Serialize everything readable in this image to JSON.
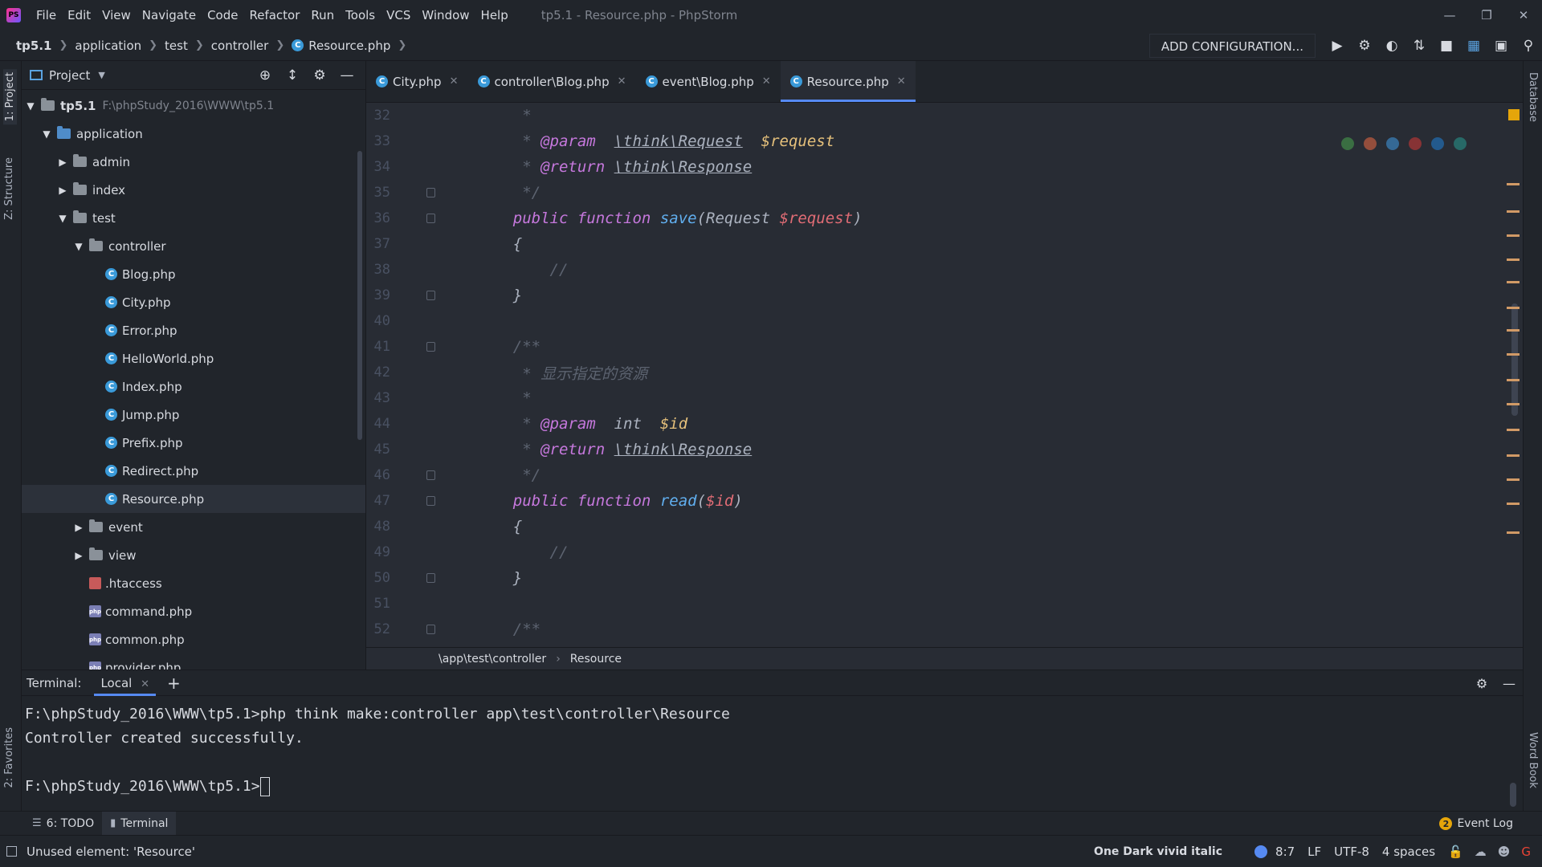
{
  "menu": [
    "File",
    "Edit",
    "View",
    "Navigate",
    "Code",
    "Refactor",
    "Run",
    "Tools",
    "VCS",
    "Window",
    "Help"
  ],
  "window_title": "tp5.1 - Resource.php - PhpStorm",
  "breadcrumbs": [
    "tp5.1",
    "application",
    "test",
    "controller",
    "Resource.php"
  ],
  "run_config": "ADD CONFIGURATION...",
  "left_tabs": {
    "project": "1: Project",
    "structure": "Z: Structure",
    "favorites": "2: Favorites"
  },
  "right_tabs": {
    "database": "Database",
    "wordbook": "Word Book"
  },
  "project_panel": {
    "title": "Project",
    "root": {
      "name": "tp5.1",
      "path": "F:\\phpStudy_2016\\WWW\\tp5.1"
    },
    "tree": [
      {
        "label": "application",
        "depth": 1,
        "kind": "folder-blue",
        "expanded": true
      },
      {
        "label": "admin",
        "depth": 2,
        "kind": "folder",
        "expanded": false
      },
      {
        "label": "index",
        "depth": 2,
        "kind": "folder",
        "expanded": false
      },
      {
        "label": "test",
        "depth": 2,
        "kind": "folder",
        "expanded": true
      },
      {
        "label": "controller",
        "depth": 3,
        "kind": "folder",
        "expanded": true
      },
      {
        "label": "Blog.php",
        "depth": 4,
        "kind": "php-class"
      },
      {
        "label": "City.php",
        "depth": 4,
        "kind": "php-class"
      },
      {
        "label": "Error.php",
        "depth": 4,
        "kind": "php-class"
      },
      {
        "label": "HelloWorld.php",
        "depth": 4,
        "kind": "php-class"
      },
      {
        "label": "Index.php",
        "depth": 4,
        "kind": "php-class"
      },
      {
        "label": "Jump.php",
        "depth": 4,
        "kind": "php-class"
      },
      {
        "label": "Prefix.php",
        "depth": 4,
        "kind": "php-class"
      },
      {
        "label": "Redirect.php",
        "depth": 4,
        "kind": "php-class"
      },
      {
        "label": "Resource.php",
        "depth": 4,
        "kind": "php-class",
        "selected": true
      },
      {
        "label": "event",
        "depth": 3,
        "kind": "folder",
        "expanded": false
      },
      {
        "label": "view",
        "depth": 3,
        "kind": "folder",
        "expanded": false
      },
      {
        "label": ".htaccess",
        "depth": 3,
        "kind": "htaccess"
      },
      {
        "label": "command.php",
        "depth": 3,
        "kind": "php-file"
      },
      {
        "label": "common.php",
        "depth": 3,
        "kind": "php-file"
      },
      {
        "label": "provider.php",
        "depth": 3,
        "kind": "php-file"
      }
    ]
  },
  "editor_tabs": [
    {
      "label": "City.php",
      "active": false
    },
    {
      "label": "controller\\Blog.php",
      "active": false
    },
    {
      "label": "event\\Blog.php",
      "active": false
    },
    {
      "label": "Resource.php",
      "active": true
    }
  ],
  "code_lines": [
    {
      "n": "32",
      "t": "     *",
      "fold": false
    },
    {
      "n": "33",
      "t": "     * @param  \\think\\Request  $request",
      "fold": false
    },
    {
      "n": "34",
      "t": "     * @return \\think\\Response",
      "fold": false
    },
    {
      "n": "35",
      "t": "     */",
      "fold": true
    },
    {
      "n": "36",
      "t": "    public function save(Request $request)",
      "fold": true
    },
    {
      "n": "37",
      "t": "    {",
      "fold": false
    },
    {
      "n": "38",
      "t": "        //",
      "fold": false
    },
    {
      "n": "39",
      "t": "    }",
      "fold": true
    },
    {
      "n": "40",
      "t": "",
      "fold": false
    },
    {
      "n": "41",
      "t": "    /**",
      "fold": true
    },
    {
      "n": "42",
      "t": "     * 显示指定的资源",
      "fold": false
    },
    {
      "n": "43",
      "t": "     *",
      "fold": false
    },
    {
      "n": "44",
      "t": "     * @param  int  $id",
      "fold": false
    },
    {
      "n": "45",
      "t": "     * @return \\think\\Response",
      "fold": false
    },
    {
      "n": "46",
      "t": "     */",
      "fold": true
    },
    {
      "n": "47",
      "t": "    public function read($id)",
      "fold": true
    },
    {
      "n": "48",
      "t": "    {",
      "fold": false
    },
    {
      "n": "49",
      "t": "        //",
      "fold": false
    },
    {
      "n": "50",
      "t": "    }",
      "fold": true
    },
    {
      "n": "51",
      "t": "",
      "fold": false
    },
    {
      "n": "52",
      "t": "    /**",
      "fold": true
    }
  ],
  "editor_breadcrumb": [
    "\\app\\test\\controller",
    "Resource"
  ],
  "terminal": {
    "label": "Terminal:",
    "tab": "Local",
    "lines": [
      "F:\\phpStudy_2016\\WWW\\tp5.1>php think make:controller app\\test\\controller\\Resource",
      "Controller created successfully.",
      "",
      "F:\\phpStudy_2016\\WWW\\tp5.1>"
    ]
  },
  "tool_windows": {
    "todo": "6: TODO",
    "terminal": "Terminal",
    "event_log": "Event Log",
    "event_count": "2"
  },
  "status": {
    "message": "Unused element: 'Resource'",
    "theme": "One Dark vivid italic",
    "position": "8:7",
    "line_sep": "LF",
    "encoding": "UTF-8",
    "indent": "4 spaces"
  },
  "colors": {
    "accent": "#568af2",
    "keyword": "#c678dd",
    "function": "#61afef",
    "variable": "#e5c07b",
    "comment": "#5c6370",
    "warning": "#d19a66"
  }
}
